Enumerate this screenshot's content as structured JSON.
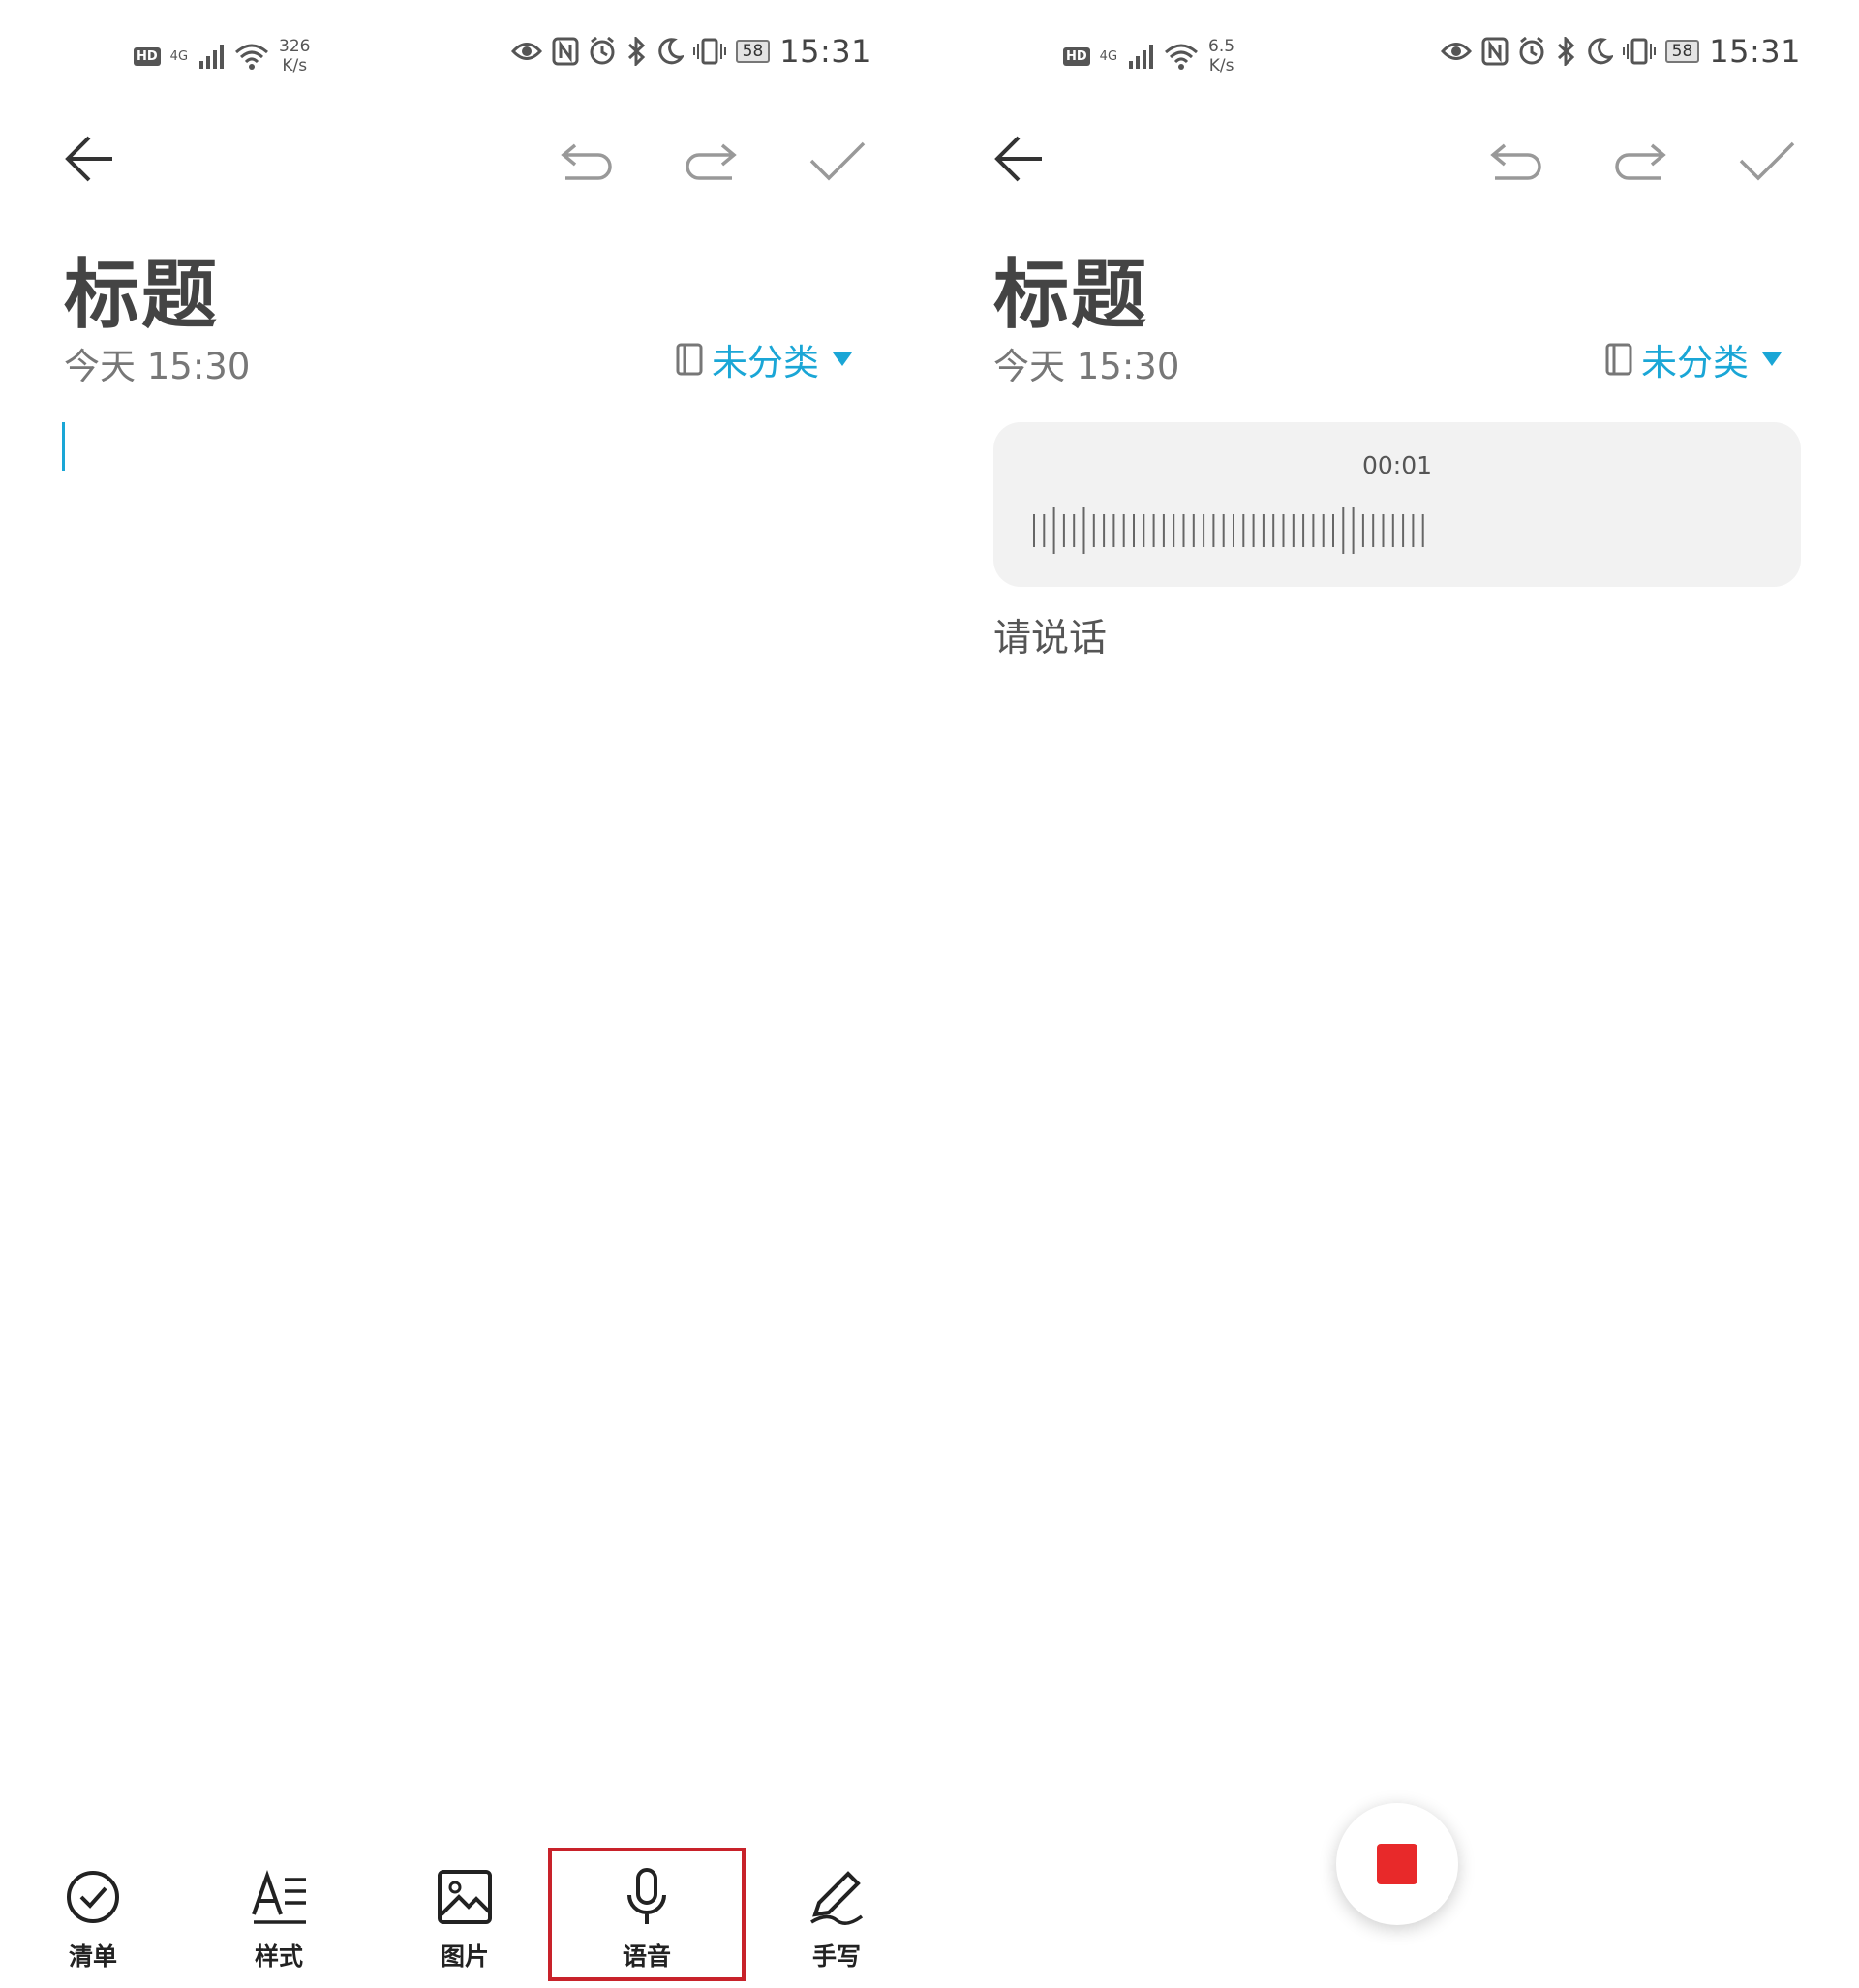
{
  "screens": [
    {
      "status": {
        "network": "4G",
        "speed_value": "326",
        "speed_unit": "K/s",
        "battery": "58",
        "time": "15:31",
        "hd": "HD"
      },
      "note": {
        "title": "标题",
        "date": "今天 15:30",
        "category": "未分类"
      },
      "bottom_tools": [
        {
          "label": "清单",
          "icon": "checklist-icon"
        },
        {
          "label": "样式",
          "icon": "text-style-icon"
        },
        {
          "label": "图片",
          "icon": "image-icon"
        },
        {
          "label": "语音",
          "icon": "microphone-icon"
        },
        {
          "label": "手写",
          "icon": "pen-icon"
        }
      ]
    },
    {
      "status": {
        "network": "4G",
        "speed_value": "6.5",
        "speed_unit": "K/s",
        "battery": "58",
        "time": "15:31",
        "hd": "HD"
      },
      "note": {
        "title": "标题",
        "date": "今天 15:30",
        "category": "未分类"
      },
      "recording": {
        "elapsed": "00:01",
        "prompt": "请说话"
      }
    }
  ],
  "colors": {
    "accent": "#1aa6d6",
    "stop": "#e8292a",
    "highlight": "#c8222a"
  }
}
